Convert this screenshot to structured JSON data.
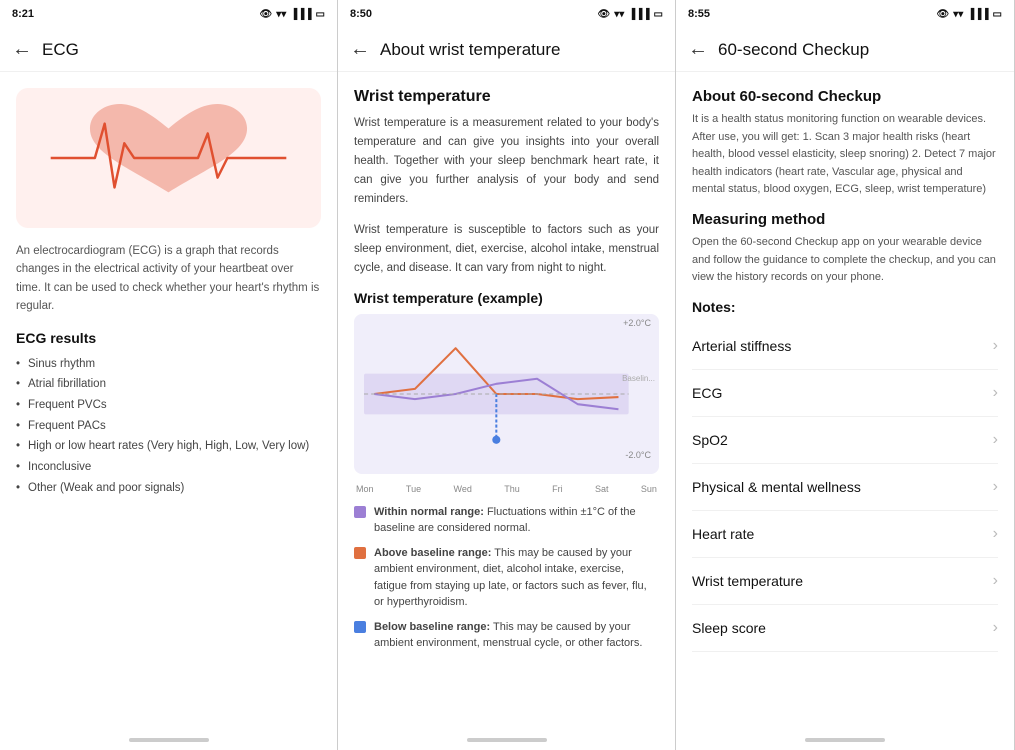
{
  "panel1": {
    "time": "8:21",
    "title": "ECG",
    "description": "An electrocardiogram (ECG) is a graph that records changes in the electrical activity of your heartbeat over time. It can be used to check whether your heart's rhythm is regular.",
    "results_title": "ECG results",
    "results": [
      "Sinus rhythm",
      "Atrial fibrillation",
      "Frequent PVCs",
      "Frequent PACs",
      "High or low heart rates (Very high, High, Low, Very low)",
      "Inconclusive",
      "Other (Weak and poor signals)"
    ]
  },
  "panel2": {
    "time": "8:50",
    "title": "About wrist temperature",
    "section1_title": "Wrist temperature",
    "section1_text1": "Wrist temperature is a measurement related to your body's temperature and can give you insights into your overall health. Together with your sleep benchmark heart rate, it can give you further analysis of your body and send reminders.",
    "section1_text2": "Wrist temperature is susceptible to factors such as your sleep environment, diet, exercise, alcohol intake, menstrual cycle, and disease. It can vary from night to night.",
    "chart_title": "Wrist temperature (example)",
    "chart_top_label": "+2.0°C",
    "chart_bottom_label": "-2.0°C",
    "chart_baseline_label": "Baselin...",
    "days": [
      "Mon",
      "Tue",
      "Wed",
      "Thu",
      "Fri",
      "Sat",
      "Sun"
    ],
    "legend": [
      {
        "color": "#9c7fd4",
        "label_bold": "Within normal range:",
        "label_text": " Fluctuations within ±1°C of the baseline are considered normal."
      },
      {
        "color": "#e07040",
        "label_bold": "Above baseline range:",
        "label_text": " This may be caused by your ambient environment, diet, alcohol intake, exercise, fatigue from staying up late, or factors such as fever, flu, or hyperthyroidism."
      },
      {
        "color": "#4a7fe0",
        "label_bold": "Below baseline range:",
        "label_text": " This may be caused by your ambient environment, menstrual cycle, or other factors."
      }
    ]
  },
  "panel3": {
    "time": "8:55",
    "title": "60-second Checkup",
    "about_title": "About 60-second Checkup",
    "about_text": "It is a health status monitoring function on wearable devices. After use, you will get:\n1. Scan 3 major health risks (heart health, blood vessel elasticity, sleep snoring)\n2. Detect 7 major health indicators (heart rate, Vascular age, physical and mental status, blood oxygen, ECG, sleep, wrist temperature)",
    "measuring_title": "Measuring method",
    "measuring_text": "Open the 60-second Checkup app on your wearable device and follow the guidance to complete the checkup, and you can view the history records on your phone.",
    "notes_label": "Notes:",
    "list_items": [
      "Arterial stiffness",
      "ECG",
      "SpO2",
      "Physical & mental wellness",
      "Heart rate",
      "Wrist temperature",
      "Sleep score"
    ]
  }
}
